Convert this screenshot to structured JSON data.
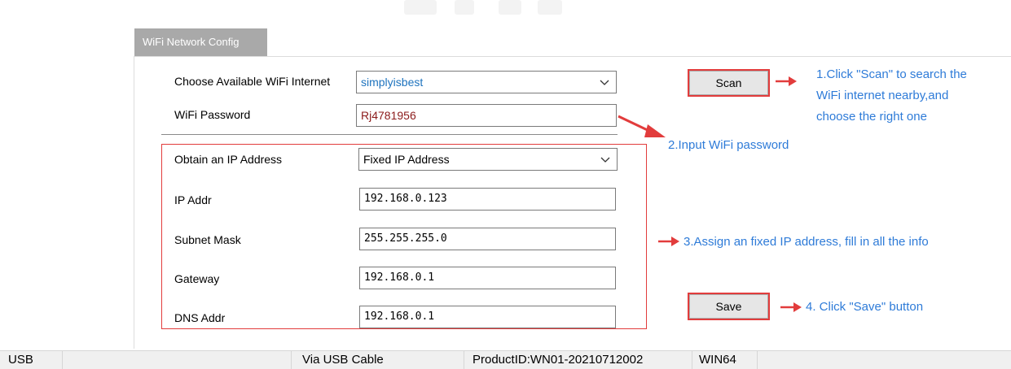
{
  "tab": {
    "label": "WiFi Network Config"
  },
  "wifi": {
    "ssid_label": "Choose Available WiFi Internet",
    "ssid_value": "simplyisbest",
    "password_label": "WiFi Password",
    "password_value": "Rj4781956"
  },
  "ip": {
    "mode_label": "Obtain an IP Address",
    "mode_value": "Fixed IP Address",
    "ip_label": "IP Addr",
    "ip_value": "192.168.0.123",
    "mask_label": "Subnet Mask",
    "mask_value": "255.255.255.0",
    "gateway_label": "Gateway",
    "gateway_value": "192.168.0.1",
    "dns_label": "DNS Addr",
    "dns_value": "192.168.0.1"
  },
  "buttons": {
    "scan": "Scan",
    "save": "Save"
  },
  "notes": {
    "step1_line1": "1.Click \"Scan\" to search the",
    "step1_line2": "WiFi internet nearby,and",
    "step1_line3": "choose the right one",
    "step2": "2.Input WiFi password",
    "step3": "3.Assign an fixed IP address, fill in all the info",
    "step4": "4. Click \"Save\" button"
  },
  "status_bar": {
    "port": "USB",
    "connection": "Via USB Cable",
    "product_id": "ProductID:WN01-20210712002",
    "platform": "WIN64"
  },
  "colors": {
    "annotation_blue": "#2e7bd8",
    "annotation_red": "#e23c3c",
    "ssid_blue": "#1e73be",
    "password_red": "#8b1a1a"
  },
  "icons": [
    "chevron-down-icon",
    "red-arrow-icon"
  ]
}
